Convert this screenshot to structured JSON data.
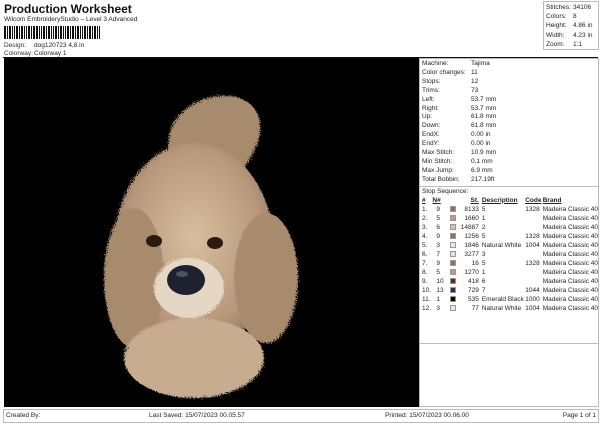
{
  "header": {
    "title": "Production Worksheet",
    "subtitle": "Wilcom EmbroideryStudio – Level 3 Advanced",
    "design_label": "Design:",
    "design_value": "dog120723 4,8 in",
    "colorway_label": "Colorway:",
    "colorway_value": "Colorway 1"
  },
  "stats": [
    {
      "k": "Stitches:",
      "v": "34106"
    },
    {
      "k": "Colors:",
      "v": "8"
    },
    {
      "k": "Height:",
      "v": "4.86 in"
    },
    {
      "k": "Width:",
      "v": "4.23 in"
    },
    {
      "k": "Zoom:",
      "v": "1:1"
    }
  ],
  "machine_info": [
    {
      "k": "Machine:",
      "v": "Tajima"
    },
    {
      "k": "Color changes:",
      "v": "11"
    },
    {
      "k": "Stops:",
      "v": "12"
    },
    {
      "k": "Trims:",
      "v": "73"
    },
    {
      "k": "Left:",
      "v": "53.7 mm"
    },
    {
      "k": "Right:",
      "v": "53.7 mm"
    },
    {
      "k": "Up:",
      "v": "61.8 mm"
    },
    {
      "k": "Down:",
      "v": "61.8 mm"
    },
    {
      "k": "EndX:",
      "v": "0.00 in"
    },
    {
      "k": "EndY:",
      "v": "0.00 in"
    },
    {
      "k": "Max Stitch:",
      "v": "10.9 mm"
    },
    {
      "k": "Min Stitch:",
      "v": "0.1 mm"
    },
    {
      "k": "Max Jump:",
      "v": "6.9 mm"
    },
    {
      "k": "Total Bobbin:",
      "v": "217.19ft"
    }
  ],
  "stop_sequence": {
    "label": "Stop Sequence:",
    "headers": [
      "#",
      "N#",
      "St.",
      "Description",
      "Code",
      "Brand"
    ],
    "rows": [
      {
        "n": "1.",
        "needle": "9",
        "color": "#8a7062",
        "st": "8133",
        "desc": "5",
        "code": "1328",
        "brand": "Madeira Classic 40"
      },
      {
        "n": "2.",
        "needle": "5",
        "color": "#c8967c",
        "st": "1660",
        "desc": "1",
        "code": "",
        "brand": "Madeira Classic 40"
      },
      {
        "n": "3.",
        "needle": "6",
        "color": "#dcbca6",
        "st": "14887",
        "desc": "2",
        "code": "",
        "brand": "Madeira Classic 40"
      },
      {
        "n": "4.",
        "needle": "9",
        "color": "#8a7062",
        "st": "1256",
        "desc": "5",
        "code": "1328",
        "brand": "Madeira Classic 40"
      },
      {
        "n": "5.",
        "needle": "3",
        "color": "#e8e8f0",
        "st": "1846",
        "desc": "Natural White",
        "code": "1004",
        "brand": "Madeira Classic 40"
      },
      {
        "n": "6.",
        "needle": "7",
        "color": "#f2ddd0",
        "st": "3277",
        "desc": "3",
        "code": "",
        "brand": "Madeira Classic 40"
      },
      {
        "n": "7.",
        "needle": "9",
        "color": "#8a7062",
        "st": "16",
        "desc": "5",
        "code": "1328",
        "brand": "Madeira Classic 40"
      },
      {
        "n": "8.",
        "needle": "5",
        "color": "#c8967c",
        "st": "1270",
        "desc": "1",
        "code": "",
        "brand": "Madeira Classic 40"
      },
      {
        "n": "9.",
        "needle": "10",
        "color": "#5a2a22",
        "st": "418",
        "desc": "6",
        "code": "",
        "brand": "Madeira Classic 40"
      },
      {
        "n": "10.",
        "needle": "13",
        "color": "#2a3050",
        "st": "729",
        "desc": "7",
        "code": "1044",
        "brand": "Madeira Classic 40"
      },
      {
        "n": "11.",
        "needle": "1",
        "color": "#000000",
        "st": "535",
        "desc": "Emerald Black",
        "code": "1000",
        "brand": "Madeira Classic 40"
      },
      {
        "n": "12.",
        "needle": "3",
        "color": "#e8e8f0",
        "st": "77",
        "desc": "Natural White",
        "code": "1004",
        "brand": "Madeira Classic 40"
      }
    ]
  },
  "footer": {
    "created_by": "Created By:",
    "last_saved": "Last Saved: 15/07/2023 00.05.57",
    "printed": "Printed: 15/07/2023 00.06.00",
    "page": "Page 1 of 1"
  }
}
